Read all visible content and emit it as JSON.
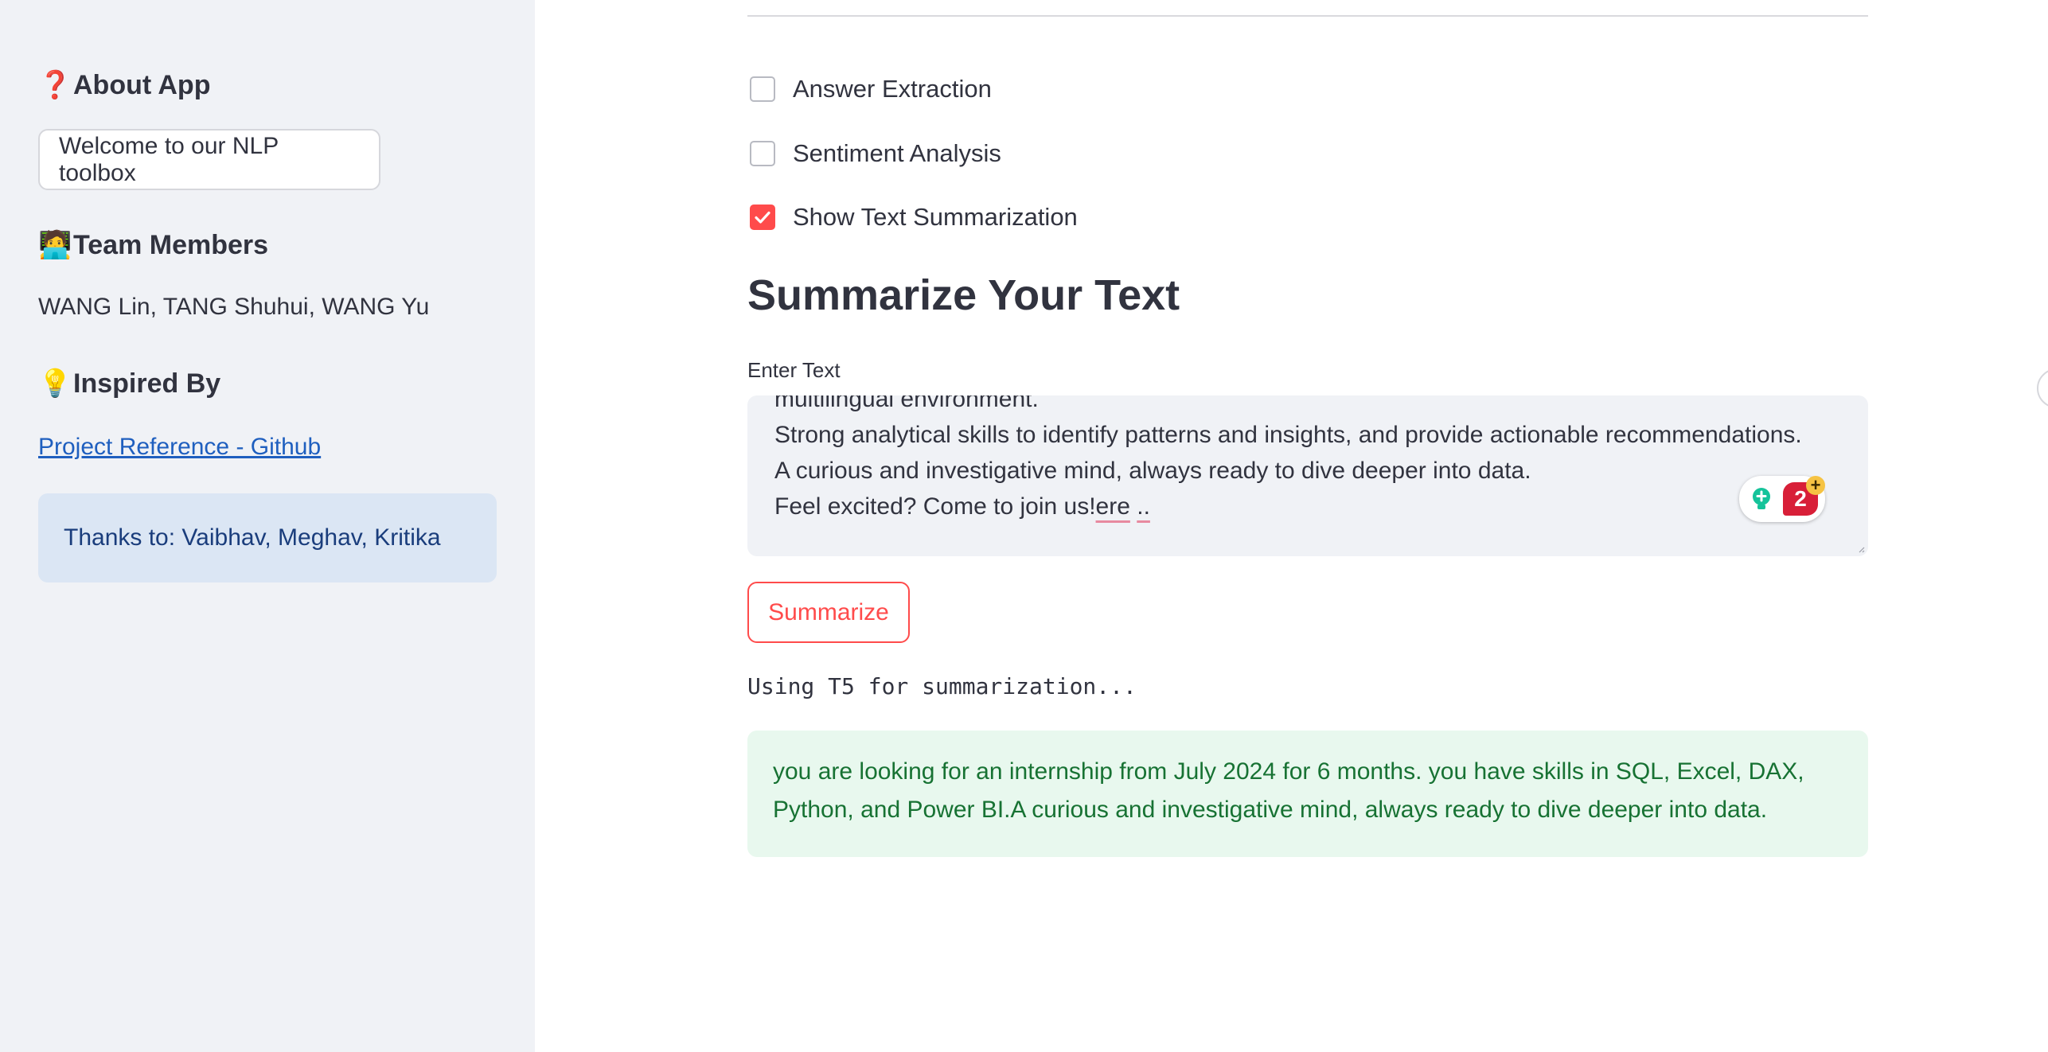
{
  "sidebar": {
    "about": {
      "emoji": "❓",
      "title": "About App"
    },
    "welcome_button": "Welcome to our NLP toolbox",
    "team": {
      "emoji": "🧑‍💻",
      "title": "Team Members"
    },
    "team_members": "WANG Lin, TANG Shuhui, WANG Yu",
    "inspired": {
      "emoji": "💡",
      "title": "Inspired By"
    },
    "project_link": "Project Reference - Github",
    "thanks": "Thanks to: Vaibhav, Meghav, Kritika"
  },
  "main": {
    "checkboxes": [
      {
        "label": "Answer Extraction",
        "checked": false
      },
      {
        "label": "Sentiment Analysis",
        "checked": false
      },
      {
        "label": "Show Text Summarization",
        "checked": true
      }
    ],
    "title": "Summarize Your Text",
    "input_label": "Enter Text",
    "textarea_lines": [
      "multilingual environment.",
      "Strong analytical skills to identify patterns and insights, and provide actionable recommendations.",
      "A curious and investigative mind, always ready to dive deeper into data."
    ],
    "textarea_last_line_prefix": "Feel excited? Come to join us!",
    "textarea_last_line_misspelled_1": "ere",
    "textarea_last_line_misspelled_2": "..",
    "grammar_count": "2",
    "summarize_button": "Summarize",
    "status_text": "Using T5 for summarization...",
    "result_text": "you are looking for an internship from July 2024 for 6 months. you have skills in SQL, Excel, DAX, Python, and Power BI.A curious and investigative mind, always ready to dive deeper into data."
  },
  "colors": {
    "sidebar_bg": "#f0f2f6",
    "accent": "#ff4b4b",
    "link": "#1f5fbf",
    "info_bg": "#dbe6f4",
    "success_bg": "#e8f8ee",
    "success_text": "#177233"
  }
}
